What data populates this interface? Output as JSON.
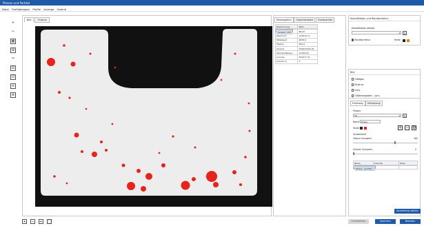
{
  "window": {
    "title": "Phasen und Partikel"
  },
  "menu": [
    "Datei",
    "Profilabeagen",
    "Profile",
    "Anzeige",
    "Galerie"
  ],
  "left_tools": [
    {
      "icon": "plus-icon",
      "glyph": "+"
    },
    {
      "icon": "fit-width-icon",
      "glyph": "⇿"
    },
    {
      "icon": "pattern-icon",
      "glyph": "▩"
    },
    {
      "icon": "measure-box-icon",
      "glyph": "⊞"
    },
    {
      "icon": "scissors-icon",
      "glyph": "✂"
    },
    {
      "icon": "zoom-box-icon",
      "glyph": "⊟"
    },
    {
      "icon": "zoom-region-icon",
      "glyph": "⊡"
    },
    {
      "icon": "layer-icon",
      "glyph": "≡"
    },
    {
      "icon": "layer2-icon",
      "glyph": "≣"
    }
  ],
  "image_tabs": [
    "Bild",
    "Original"
  ],
  "stats": {
    "tabs": [
      "Messergebnis",
      "Gesamtstatistik",
      "Einzelpartikel"
    ],
    "headers": [
      "Bezeichnung",
      "Wert"
    ],
    "rows": [
      {
        "label": "Anzahl",
        "value": "157"
      },
      {
        "label": "Minimum",
        "value": "68,22"
      },
      {
        "label": "Maximum",
        "value": "122634,77"
      },
      {
        "label": "Mittelwert",
        "value": "6878,6"
      },
      {
        "label": "Median",
        "value": "566,9"
      },
      {
        "label": "Varianz",
        "value": "259624434,36"
      },
      {
        "label": "Standardabwei...",
        "value": "11399,63"
      },
      {
        "label": "Summe",
        "value": "352977,37"
      },
      {
        "label": "Summe %",
        "value": "3"
      }
    ]
  },
  "right": {
    "klassifikation": {
      "title": "Klassifikation und Randkorrektur",
      "label": "Klassifikation wählen",
      "select_value": "",
      "checkbox": "Randkorrektur",
      "farbe_label": "Farbe"
    },
    "bild": {
      "title": "Bild",
      "options": [
        "Glättgen",
        "Binärnis",
        "Inkra",
        "Größenangaben"
      ],
      "unit": "(um)",
      "range_from": "1423,31",
      "range_to": "5856,95",
      "sep": "µ"
    },
    "phase": {
      "tabs": [
        "Einphasig",
        "Mehrphasig"
      ],
      "phasen_label": "Phasen",
      "phasen_value": "Sw",
      "name_label": "Name",
      "name_value": "Phase",
      "farbe_label": "Farbe",
      "schwellwert_label": "Schwellwert",
      "oben_label": "Oberer Grauwert",
      "oben_value": "182",
      "unten_label": "Unterer Grauwert",
      "unten_value": "0",
      "table_headers": [
        "Name",
        "Intervall",
        "Farbe"
      ],
      "table_rows": [
        {
          "name": "Phase",
          "interval": "[0;182]",
          "color": "#e8231c"
        }
      ]
    },
    "auswertung_button": "Auswertung starten"
  },
  "bottom": {
    "tools": [
      "+",
      "−",
      "⇔",
      "⛶"
    ],
    "buttons": {
      "grey": "Ersetzbehlen",
      "b1": "Speichern",
      "b2": "Beenden"
    }
  },
  "colors": {
    "accent": "#1e5aa8",
    "particle": "#e8231c",
    "sample": "#ededed",
    "background": "#111111"
  }
}
